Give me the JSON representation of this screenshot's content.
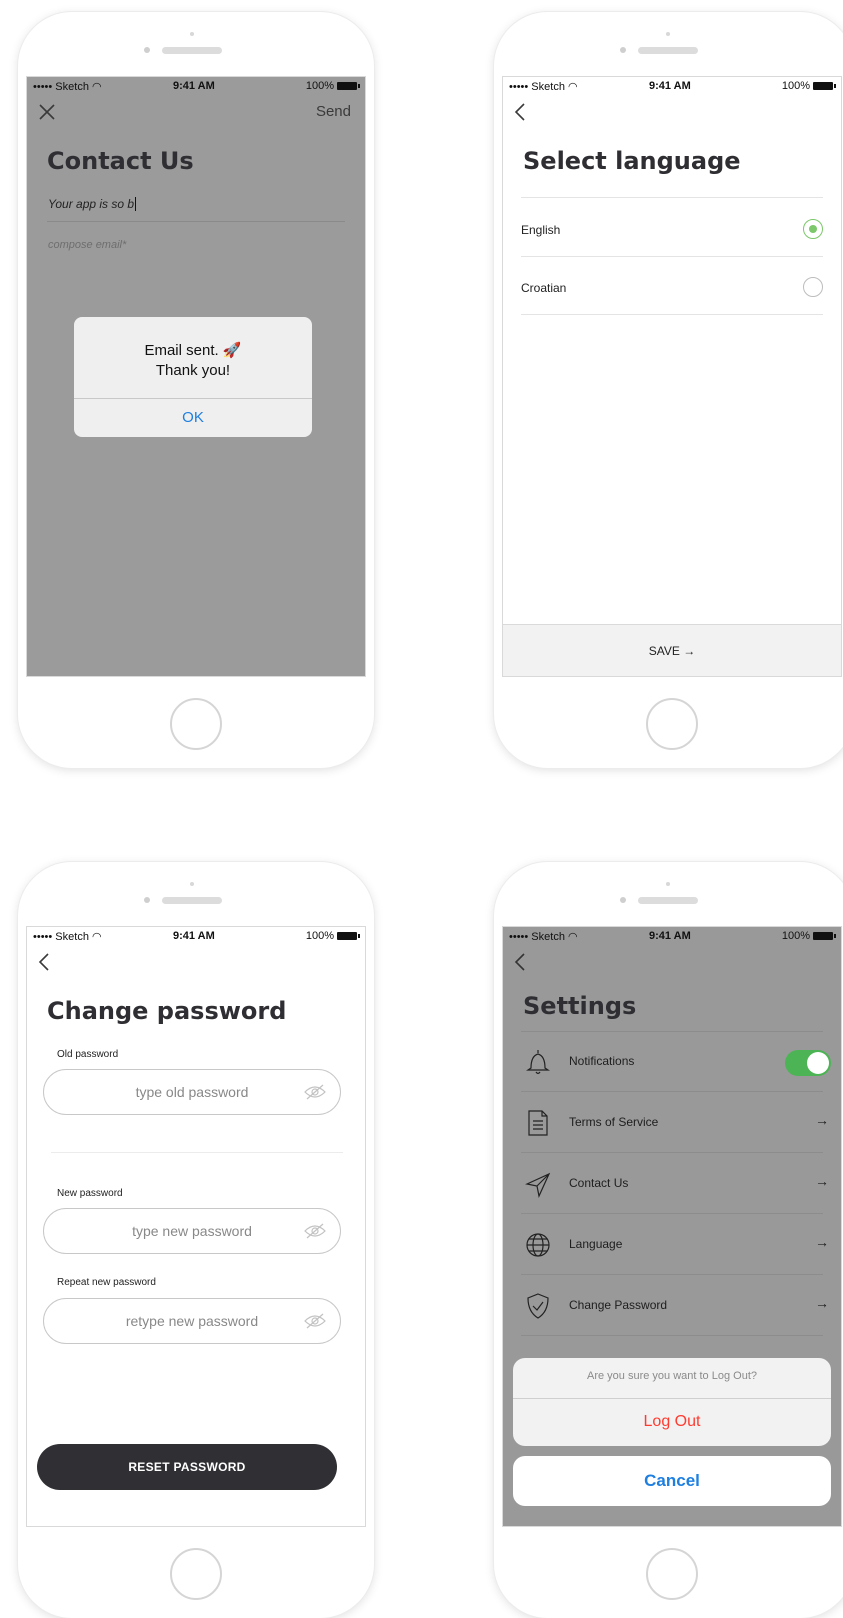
{
  "status_bar": {
    "carrier": "••••• Sketch ◠",
    "time": "9:41 AM",
    "battery": "100%"
  },
  "contact_screen": {
    "close_icon": "close-icon",
    "send_label": "Send",
    "title": "Contact Us",
    "subject_value": "Your app is so b",
    "body_placeholder": "compose email*",
    "alert": {
      "message_line1": "Email sent. 🚀",
      "message_line2": "Thank you!",
      "ok_label": "OK"
    }
  },
  "language_screen": {
    "back_icon": "chevron-left-icon",
    "title": "Select language",
    "options": [
      {
        "label": "English",
        "selected": true
      },
      {
        "label": "Croatian",
        "selected": false
      }
    ],
    "save_label": "SAVE →",
    "accent_color": "#7cc86a"
  },
  "password_screen": {
    "back_icon": "chevron-left-icon",
    "title": "Change password",
    "old_label": "Old password",
    "old_placeholder": "type old password",
    "new_label": "New password",
    "new_placeholder": "type new password",
    "repeat_label": "Repeat new password",
    "repeat_placeholder": "retype new password",
    "reset_label": "RESET PASSWORD",
    "eye_icon": "eye-hidden-icon"
  },
  "settings_screen": {
    "back_icon": "chevron-left-icon",
    "title": "Settings",
    "items": [
      {
        "label": "Notifications",
        "icon": "bell-icon",
        "toggle_on": true
      },
      {
        "label": "Terms of Service",
        "icon": "document-icon",
        "arrow": "→"
      },
      {
        "label": "Contact Us",
        "icon": "paper-plane-icon",
        "arrow": "→"
      },
      {
        "label": "Language",
        "icon": "globe-icon",
        "arrow": "→"
      },
      {
        "label": "Change Password",
        "icon": "shield-check-icon",
        "arrow": "→"
      }
    ],
    "action_sheet": {
      "question": "Are you sure you want to Log Out?",
      "logout_label": "Log Out",
      "cancel_label": "Cancel"
    },
    "toggle_color": "#4cb454"
  }
}
